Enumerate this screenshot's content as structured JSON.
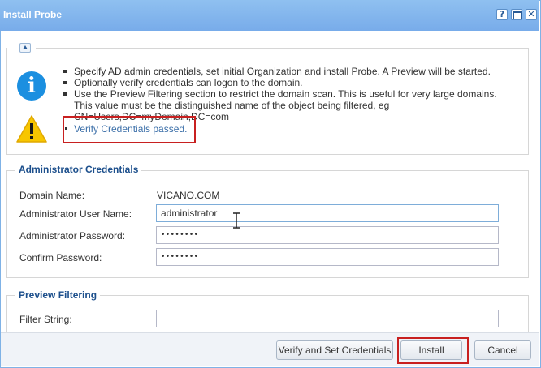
{
  "window": {
    "title": "Install Probe",
    "help_label": "?",
    "close_label": "✕"
  },
  "info": {
    "bullets": [
      "Specify AD admin credentials, set initial Organization and install Probe. A Preview will be started.",
      "Optionally verify credentials can logon to the domain.",
      "Use the Preview Filtering section to restrict the domain scan. This is useful for very large domains. This value must be the distinguished name of the object being filtered, eg CN=Users,DC=myDomain,DC=com"
    ],
    "status_text": "Verify Credentials passed.",
    "info_icon_glyph": "i",
    "info_icon": "info-icon",
    "warning_icon": "warning-icon"
  },
  "admin_credentials": {
    "legend": "Administrator Credentials",
    "domain_label": "Domain Name:",
    "domain_value": "VICANO.COM",
    "username_label": "Administrator User Name:",
    "username_value": "administrator",
    "password_label": "Administrator Password:",
    "password_value": "••••••••",
    "confirm_label": "Confirm Password:",
    "confirm_value": "••••••••"
  },
  "preview_filtering": {
    "legend": "Preview Filtering",
    "filter_label": "Filter String:",
    "filter_value": ""
  },
  "footer": {
    "verify_label": "Verify and Set Credentials",
    "install_label": "Install",
    "cancel_label": "Cancel"
  },
  "colors": {
    "titlebar": "#78acea",
    "highlight_border": "#c82020",
    "legend_text": "#1c4f8c",
    "status_text": "#3a6ea8",
    "info_icon_bg": "#1b8fe0",
    "warning_icon_bg": "#f7c600"
  }
}
